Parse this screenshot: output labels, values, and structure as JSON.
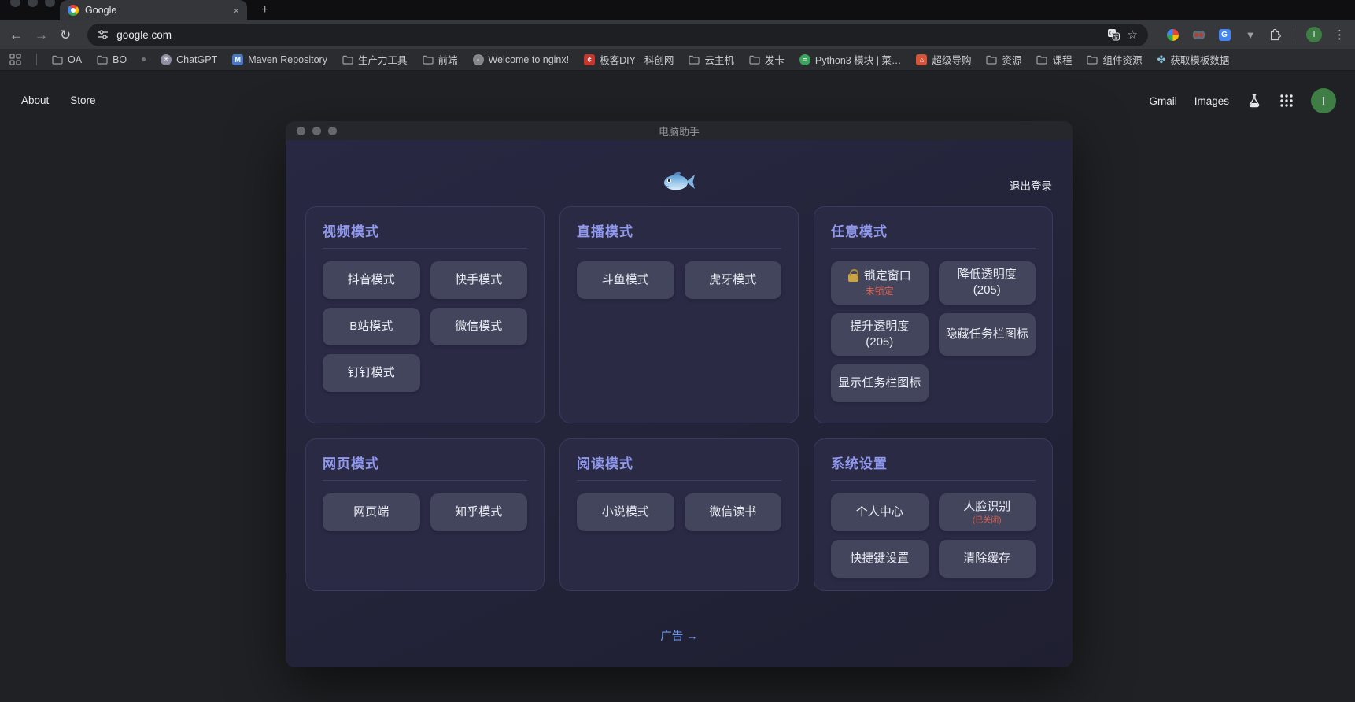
{
  "browser": {
    "tab_title": "Google",
    "tab_close": "×",
    "new_tab": "+",
    "nav": {
      "back": "←",
      "forward": "→",
      "reload": "↻"
    },
    "url": "google.com",
    "profile_initial": "I",
    "menu_glyph": "⋮",
    "star_glyph": "☆",
    "extensions": [
      {
        "name": "colorpicker-extension-icon",
        "kind": "colorwheel"
      },
      {
        "name": "goggles-extension-icon",
        "kind": "goggles"
      },
      {
        "name": "google-translate-extension-icon",
        "kind": "gtrans",
        "letter": "G"
      },
      {
        "name": "vue-devtools-extension-icon",
        "kind": "vuedev",
        "glyph": "▼"
      }
    ]
  },
  "bookmarks": {
    "items": [
      {
        "icon": "folder",
        "label": "OA"
      },
      {
        "icon": "folder",
        "label": "BO"
      },
      {
        "icon": "dot",
        "label": ""
      },
      {
        "icon": "chatgpt",
        "label": "ChatGPT",
        "bg": "#8e8ea0",
        "glyph": "✳"
      },
      {
        "icon": "maven",
        "label": "Maven Repository",
        "bg": "#4a77c8",
        "glyph": "M"
      },
      {
        "icon": "folder",
        "label": "生产力工具"
      },
      {
        "icon": "folder",
        "label": "前端"
      },
      {
        "icon": "nginx",
        "label": "Welcome to nginx!",
        "bg": "#85878b",
        "glyph": "◦"
      },
      {
        "icon": "geek",
        "label": "极客DIY - 科创网",
        "bg": "#c8372d",
        "glyph": "¢"
      },
      {
        "icon": "folder",
        "label": "云主机"
      },
      {
        "icon": "folder",
        "label": "发卡"
      },
      {
        "icon": "python",
        "label": "Python3 模块 | 菜…",
        "bg": "#3aa35c",
        "glyph": "≡"
      },
      {
        "icon": "super",
        "label": "超级导购",
        "bg": "#d4553a",
        "glyph": "⌂"
      },
      {
        "icon": "folder",
        "label": "资源"
      },
      {
        "icon": "folder",
        "label": "课程"
      },
      {
        "icon": "folder",
        "label": "组件资源"
      },
      {
        "icon": "leaf",
        "label": "获取模板数据",
        "color": "#86c5de",
        "glyph": "✤"
      }
    ]
  },
  "google_page": {
    "about_label": "About",
    "store_label": "Store",
    "gmail_label": "Gmail",
    "images_label": "Images",
    "profile_initial": "I"
  },
  "assistant": {
    "window_title": "电脑助手",
    "logout_label": "退出登录",
    "ad_label": "广告 →",
    "panels": [
      {
        "title": "视频模式",
        "buttons": [
          {
            "label": "抖音模式"
          },
          {
            "label": "快手模式"
          },
          {
            "label": "B站模式"
          },
          {
            "label": "微信模式"
          },
          {
            "label": "钉钉模式"
          }
        ]
      },
      {
        "title": "直播模式",
        "buttons": [
          {
            "label": "斗鱼模式"
          },
          {
            "label": "虎牙模式"
          }
        ]
      },
      {
        "title": "任意模式",
        "buttons": [
          {
            "label": "锁定窗口",
            "icon": "lock-icon",
            "sub": "未锁定"
          },
          {
            "label": "降低透明度",
            "label2": "(205)"
          },
          {
            "label": "提升透明度",
            "label2": "(205)"
          },
          {
            "label": "隐藏任务栏图标"
          },
          {
            "label": "显示任务栏图标"
          }
        ]
      },
      {
        "title": "网页模式",
        "buttons": [
          {
            "label": "网页端"
          },
          {
            "label": "知乎模式"
          }
        ]
      },
      {
        "title": "阅读模式",
        "buttons": [
          {
            "label": "小说模式"
          },
          {
            "label": "微信读书"
          }
        ]
      },
      {
        "title": "系统设置",
        "buttons": [
          {
            "label": "个人中心"
          },
          {
            "label": "人脸识别",
            "sub": "(已关闭)",
            "subSmall": true
          },
          {
            "label": "快捷键设置"
          },
          {
            "label": "清除缓存"
          }
        ]
      }
    ]
  },
  "colors": {
    "accent_header": "#9099ee",
    "warning_red": "#dd5f4c",
    "link_blue": "#6d9af5",
    "lock_gold": "#c9a445",
    "avatar_green": "#3e7e44"
  }
}
